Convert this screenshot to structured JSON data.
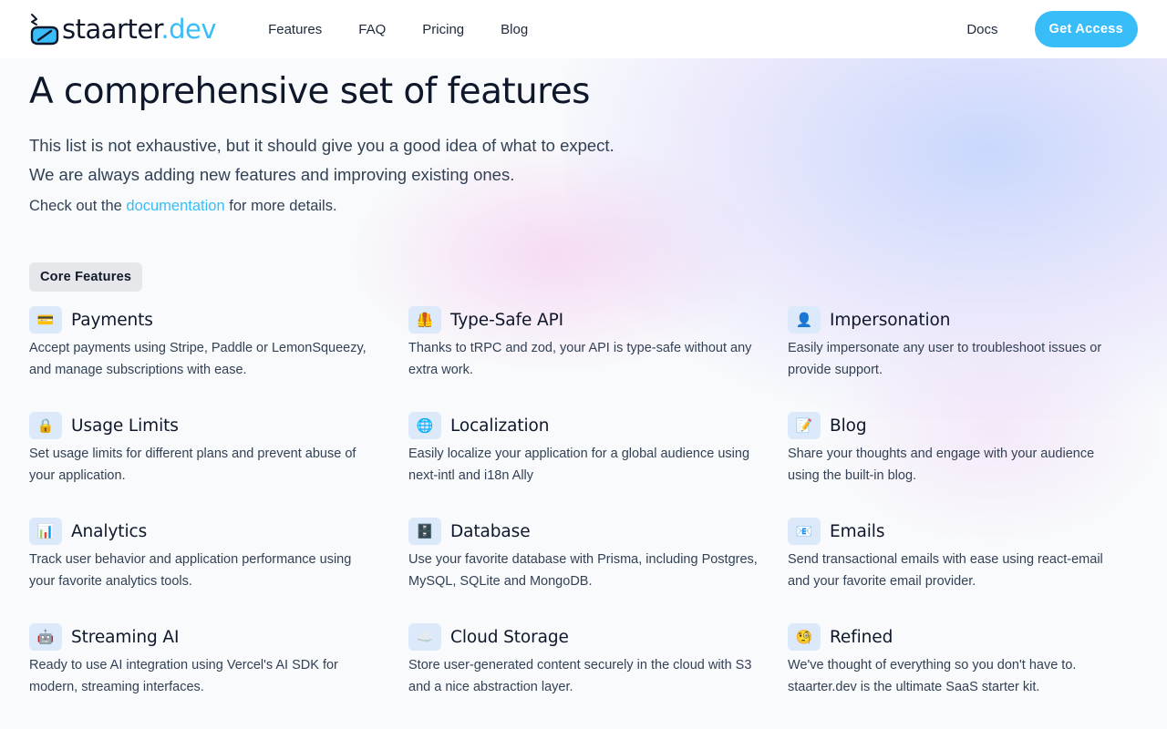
{
  "header": {
    "logo": {
      "text_main": "staarter",
      "text_accent": ".dev"
    },
    "nav": [
      {
        "label": "Features"
      },
      {
        "label": "FAQ"
      },
      {
        "label": "Pricing"
      },
      {
        "label": "Blog"
      }
    ],
    "docs_label": "Docs",
    "cta_label": "Get Access"
  },
  "hero": {
    "title": "A comprehensive set of features",
    "intro": "This list is not exhaustive, but it should give you a good idea of what to expect. We are always adding new features and improving existing ones.",
    "more_prefix": "Check out the",
    "more_link": "documentation",
    "more_suffix": "for more details."
  },
  "section": {
    "badge": "Core Features",
    "features": [
      {
        "icon": "credit-card-icon",
        "glyph": "💳",
        "title": "Payments",
        "desc": "Accept payments using Stripe, Paddle or LemonSqueezy, and manage subscriptions with ease."
      },
      {
        "icon": "safety-vest-icon",
        "glyph": "🦺",
        "title": "Type-Safe API",
        "desc": "Thanks to tRPC and zod, your API is type-safe without any extra work."
      },
      {
        "icon": "user-icon",
        "glyph": "👤",
        "title": "Impersonation",
        "desc": "Easily impersonate any user to troubleshoot issues or provide support."
      },
      {
        "icon": "lock-icon",
        "glyph": "🔒",
        "title": "Usage Limits",
        "desc": "Set usage limits for different plans and prevent abuse of your application."
      },
      {
        "icon": "globe-icon",
        "glyph": "🌐",
        "title": "Localization",
        "desc": "Easily localize your application for a global audience using next-intl and i18n Ally"
      },
      {
        "icon": "memo-icon",
        "glyph": "📝",
        "title": "Blog",
        "desc": "Share your thoughts and engage with your audience using the built-in blog."
      },
      {
        "icon": "bar-chart-icon",
        "glyph": "📊",
        "title": "Analytics",
        "desc": "Track user behavior and application performance using your favorite analytics tools."
      },
      {
        "icon": "file-cabinet-icon",
        "glyph": "🗄️",
        "title": "Database",
        "desc": "Use your favorite database with Prisma, including Postgres, MySQL, SQLite and MongoDB."
      },
      {
        "icon": "email-icon",
        "glyph": "📧",
        "title": "Emails",
        "desc": "Send transactional emails with ease using react-email and your favorite email provider."
      },
      {
        "icon": "robot-icon",
        "glyph": "🤖",
        "title": "Streaming AI",
        "desc": "Ready to use AI integration using Vercel's AI SDK for modern, streaming interfaces."
      },
      {
        "icon": "cloud-icon",
        "glyph": "☁️",
        "title": "Cloud Storage",
        "desc": "Store user-generated content securely in the cloud with S3 and a nice abstraction layer."
      },
      {
        "icon": "monocle-face-icon",
        "glyph": "🧐",
        "title": "Refined",
        "desc": "We've thought of everything so you don't have to. staarter.dev is the ultimate SaaS starter kit."
      }
    ]
  },
  "colors": {
    "accent": "#38bdf8",
    "text": "#0f172a",
    "muted": "#334155",
    "icon_bg": "#dbe9fb"
  }
}
